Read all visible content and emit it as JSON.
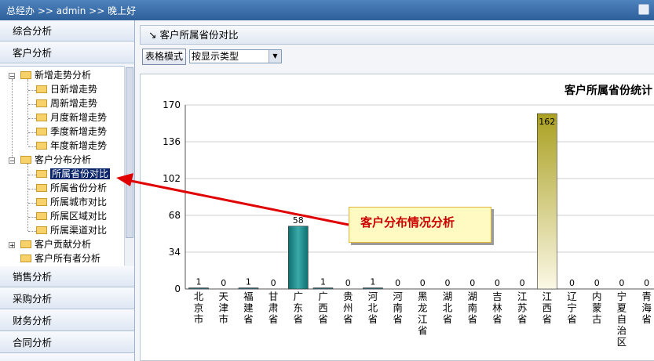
{
  "header": {
    "breadcrumb": "总经办 >> admin >> 晚上好"
  },
  "sidebar": {
    "sections": [
      {
        "label": "综合分析"
      },
      {
        "label": "客户分析"
      },
      {
        "label": "销售分析"
      },
      {
        "label": "采购分析"
      },
      {
        "label": "财务分析"
      },
      {
        "label": "合同分析"
      }
    ],
    "tree": [
      {
        "label": "新增走势分析",
        "expanded": true
      },
      {
        "label": "日新增走势"
      },
      {
        "label": "周新增走势"
      },
      {
        "label": "月度新增走势"
      },
      {
        "label": "季度新增走势"
      },
      {
        "label": "年度新增走势"
      },
      {
        "label": "客户分布分析",
        "expanded": true
      },
      {
        "label": "所属省份对比",
        "selected": true
      },
      {
        "label": "所属省份分析"
      },
      {
        "label": "所属城市对比"
      },
      {
        "label": "所属区域对比"
      },
      {
        "label": "所属渠道对比"
      },
      {
        "label": "客户贡献分析",
        "expanded": false
      },
      {
        "label": "客户所有者分析"
      }
    ]
  },
  "panel": {
    "title": "客户所属省份对比",
    "table_mode_button": "表格模式",
    "display_type_select": "按显示类型"
  },
  "callout": {
    "text": "客户分布情况分析"
  },
  "colors": {
    "header_bg": "#3d72ad",
    "bar_teal": "#1f8c8c",
    "bar_olive": "#aaa021",
    "callout_text": "#cc0000",
    "arrow": "#e00000"
  },
  "chart_data": {
    "type": "bar",
    "title": "客户所属省份统计",
    "categories": [
      "北京市",
      "天津市",
      "福建省",
      "甘肃省",
      "广东省",
      "广西省",
      "贵州省",
      "河北省",
      "河南省",
      "黑龙江省",
      "湖北省",
      "湖南省",
      "吉林省",
      "江苏省",
      "江西省",
      "辽宁省",
      "内蒙古",
      "宁夏自治区",
      "青海省"
    ],
    "values": [
      1,
      0,
      1,
      0,
      58,
      1,
      0,
      1,
      0,
      0,
      0,
      0,
      0,
      0,
      162,
      0,
      0,
      0,
      0
    ],
    "yticks": [
      0,
      34,
      68,
      102,
      136,
      170
    ],
    "ylim": [
      0,
      170
    ],
    "grid": true
  }
}
